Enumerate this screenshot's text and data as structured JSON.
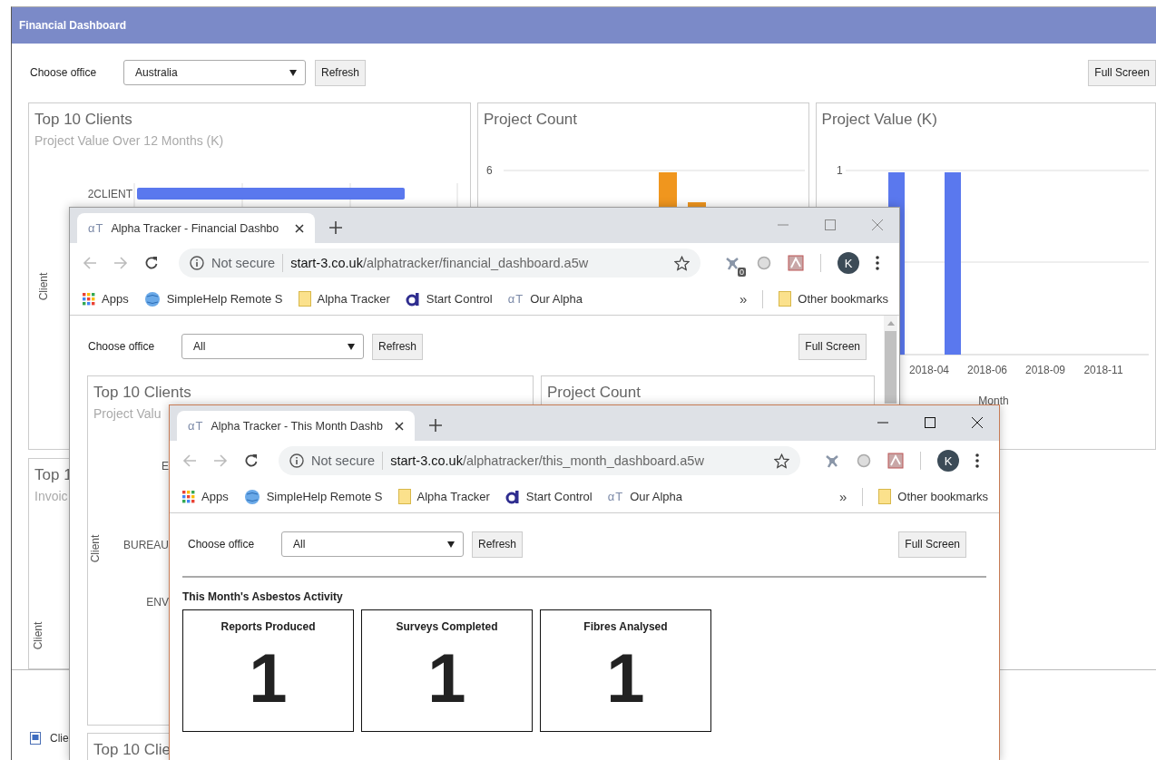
{
  "dashboard": {
    "title": "Financial Dashboard",
    "office_label": "Choose office",
    "office": "Australia",
    "refresh_button": "Refresh",
    "full_screen_button": "Full Screen",
    "panels": [
      {
        "kind": "clients",
        "title": "Top 10 Clients",
        "subtitle": "Project Value Over 12 Months (K)",
        "axis_title": "Client",
        "categories": [
          "2CLIENT"
        ]
      },
      {
        "kind": "count",
        "title": "Project Count",
        "y_ticks": [
          "6"
        ]
      },
      {
        "kind": "value",
        "title": "Project Value (K)",
        "y_ticks": [
          "1"
        ],
        "x_ticks": [
          "2018-04",
          "2018-06",
          "2018-09",
          "2018-11"
        ],
        "x_title": "Month"
      },
      {
        "kind": "invoices",
        "title": "Top 1",
        "subtitle": "Invoic",
        "axis_title": "Client"
      }
    ],
    "footer_item": "Clie"
  },
  "browser_windows": [
    {
      "active": false,
      "tab": {
        "icon_text": "αT",
        "title": "Alpha Tracker - Financial Dashbo"
      },
      "security": "Not secure",
      "url_host": "start-3.co.uk",
      "url_path": "/alphatracker/financial_dashboard.a5w",
      "extension_badge": "0",
      "profile": "K",
      "bookmarks": [
        {
          "kind": "apps",
          "label": "Apps"
        },
        {
          "kind": "globe",
          "label": "SimpleHelp Remote S"
        },
        {
          "kind": "folder",
          "label": "Alpha Tracker"
        },
        {
          "kind": "logo",
          "label": "Start Control"
        },
        {
          "kind": "text-icon",
          "icon_text": "αT",
          "label": "Our Alpha"
        }
      ],
      "overflow": "»",
      "other_bookmarks": "Other bookmarks",
      "page": {
        "kind": "financial",
        "office_label": "Choose office",
        "office": "All",
        "refresh_button": "Refresh",
        "full_screen_button": "Full Screen",
        "panels": [
          {
            "title": "Top 10 Clients",
            "subtitle": "Project Valu",
            "axis_title": "Client",
            "categories": [
              "E",
              "BUREAU",
              "ENV"
            ]
          },
          {
            "title": "Project Count"
          },
          {
            "title": "Top 10 Clie"
          }
        ]
      }
    },
    {
      "active": true,
      "tab": {
        "icon_text": "αT",
        "title": "Alpha Tracker - This Month Dashb"
      },
      "security": "Not secure",
      "url_host": "start-3.co.uk",
      "url_path": "/alphatracker/this_month_dashboard.a5w",
      "profile": "K",
      "bookmarks": [
        {
          "kind": "apps",
          "label": "Apps"
        },
        {
          "kind": "globe",
          "label": "SimpleHelp Remote S"
        },
        {
          "kind": "folder",
          "label": "Alpha Tracker"
        },
        {
          "kind": "logo",
          "label": "Start Control"
        },
        {
          "kind": "text-icon",
          "icon_text": "αT",
          "label": "Our Alpha"
        }
      ],
      "overflow": "»",
      "other_bookmarks": "Other bookmarks",
      "page": {
        "kind": "activity",
        "office_label": "Choose office",
        "office": "All",
        "refresh_button": "Refresh",
        "full_screen_button": "Full Screen",
        "heading": "This Month's Asbestos Activity",
        "cards": [
          {
            "label": "Reports Produced",
            "value": "1"
          },
          {
            "label": "Surveys Completed",
            "value": "1"
          },
          {
            "label": "Fibres Analysed",
            "value": "1"
          }
        ]
      }
    }
  ]
}
